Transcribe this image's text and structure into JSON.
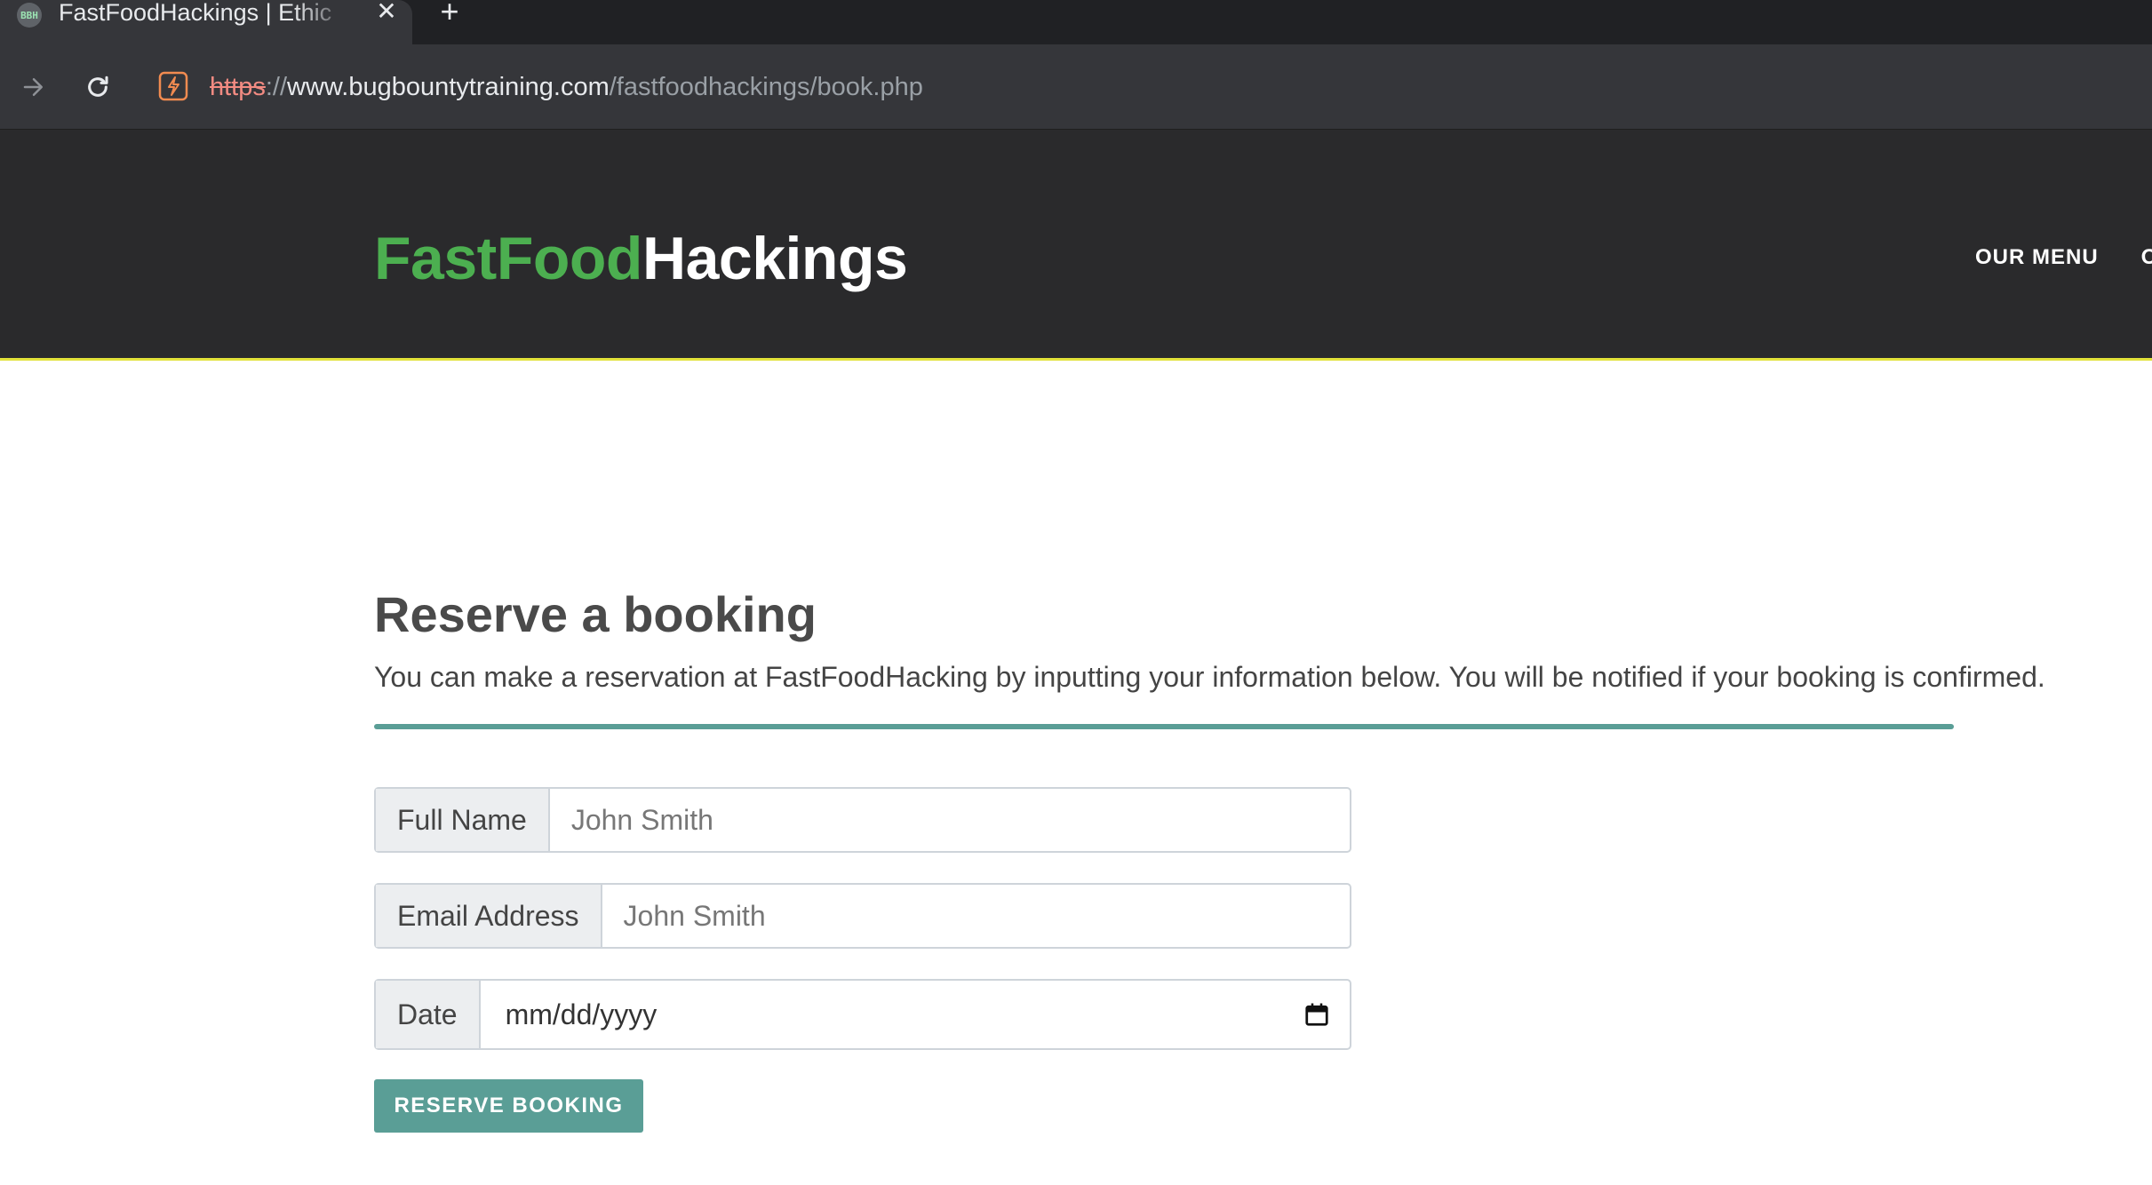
{
  "browser": {
    "tab": {
      "favicon_text": "BBH",
      "title": "FastFoodHackings | Ethic",
      "close_glyph": "✕"
    },
    "new_tab_glyph": "+",
    "url": {
      "scheme": "https",
      "separator": "://",
      "host": "www.bugbountytraining.com",
      "path": "/fastfoodhackings/book.php"
    }
  },
  "site": {
    "logo": {
      "part1": "FastFood",
      "part2": "Hackings"
    },
    "nav": [
      "OUR MENU",
      "O"
    ],
    "colors": {
      "header_bg": "#2a2a2c",
      "brand_green": "#4caf50",
      "accent_teal": "#5a9e96",
      "header_border": "#e2e23a"
    }
  },
  "booking": {
    "title": "Reserve a booking",
    "intro": "You can make a reservation at FastFoodHacking by inputting your information below. You will be notified if your booking is confirmed.",
    "fields": {
      "full_name": {
        "label": "Full Name",
        "placeholder": "John Smith",
        "value": ""
      },
      "email": {
        "label": "Email Address",
        "placeholder": "John Smith",
        "value": ""
      },
      "date": {
        "label": "Date",
        "value": "mm/dd/yyyy"
      }
    },
    "submit_label": "RESERVE BOOKING"
  },
  "icons": [
    "forward-icon",
    "reload-icon",
    "not-secure-icon",
    "calendar-icon",
    "close-icon",
    "plus-icon"
  ]
}
